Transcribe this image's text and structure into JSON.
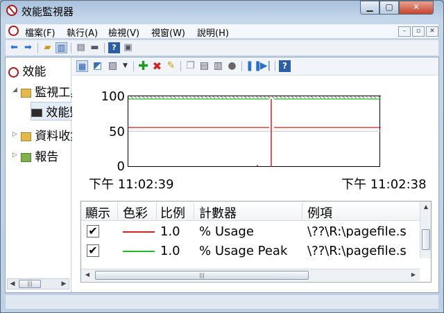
{
  "window": {
    "title": "效能監視器",
    "min_glyph": "▁",
    "max_glyph": "▢",
    "close_glyph": "✕"
  },
  "menu": {
    "items": [
      "檔案(F)",
      "執行(A)",
      "檢視(V)",
      "視窗(W)",
      "說明(H)"
    ],
    "mdi_glyphs": [
      "–",
      "▫",
      "✕"
    ]
  },
  "toolbar": {
    "icons": [
      "back-arrow-icon",
      "forward-arrow-icon",
      "up-folder-icon",
      "show-tree-icon",
      "properties-icon",
      "print-icon",
      "help-icon",
      "console-icon"
    ]
  },
  "tree": {
    "root": "效能",
    "monitor": "監視工具",
    "perf": "效能監視器",
    "data": "資料收集器集",
    "reports": "報告"
  },
  "graph": {
    "toolbar_icons": [
      "change-graph-icon",
      "copy-icon",
      "paste-icon",
      "dropdown-icon",
      "add-counter-icon",
      "delete-counter-icon",
      "highlight-icon",
      "copy-properties-icon",
      "paste-list-icon",
      "properties-icon",
      "zoom-icon",
      "freeze-display-icon",
      "update-data-icon",
      "help-icon"
    ],
    "y_ticks": [
      "100",
      "50",
      "0"
    ],
    "x_start": "下午 11:02:39",
    "x_end": "下午 11:02:38"
  },
  "chart_data": {
    "type": "line",
    "ylim": [
      0,
      100
    ],
    "series": [
      {
        "name": "% Usage",
        "color": "#d32020",
        "values": [
          58,
          58
        ]
      },
      {
        "name": "% Usage Peak",
        "color": "#22bb22",
        "values": [
          100,
          100
        ]
      }
    ]
  },
  "legend_table": {
    "headers": [
      "顯示",
      "色彩",
      "比例",
      "計數器",
      "例項"
    ],
    "rows": [
      {
        "checked": "✔",
        "color": "#d32020",
        "scale": "1.0",
        "counter": "% Usage",
        "instance": "\\??\\R:\\pagefile.s"
      },
      {
        "checked": "✔",
        "color": "#22bb22",
        "scale": "1.0",
        "counter": "% Usage Peak",
        "instance": "\\??\\R:\\pagefile.s"
      }
    ]
  },
  "scroll": {
    "thumb_grip": "|||"
  }
}
